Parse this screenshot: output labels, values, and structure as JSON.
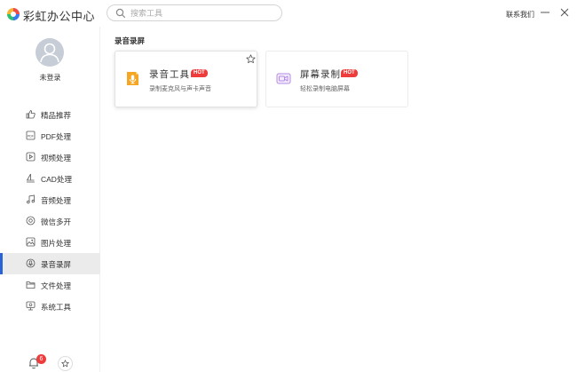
{
  "app": {
    "title": "彩虹办公中心"
  },
  "search": {
    "placeholder": "搜索工具",
    "value": ""
  },
  "header": {
    "contact": "联系我们"
  },
  "user": {
    "login_label": "未登录"
  },
  "sidebar": {
    "items": [
      {
        "label": "精品推荐",
        "icon": "thumbs-up-icon",
        "active": false
      },
      {
        "label": "PDF处理",
        "icon": "pdf-icon",
        "active": false
      },
      {
        "label": "视频处理",
        "icon": "video-icon",
        "active": false
      },
      {
        "label": "CAD处理",
        "icon": "cad-icon",
        "active": false
      },
      {
        "label": "音频处理",
        "icon": "music-note-icon",
        "active": false
      },
      {
        "label": "微信多开",
        "icon": "wechat-icon",
        "active": false
      },
      {
        "label": "图片处理",
        "icon": "image-icon",
        "active": false
      },
      {
        "label": "录音录屏",
        "icon": "record-icon",
        "active": true
      },
      {
        "label": "文件处理",
        "icon": "folder-icon",
        "active": false
      },
      {
        "label": "系统工具",
        "icon": "monitor-icon",
        "active": false
      }
    ],
    "notification_count": "6"
  },
  "main": {
    "section_title": "录音录屏",
    "cards": [
      {
        "title": "录音工具",
        "badge": "HOT",
        "desc": "录制麦克风与声卡声音",
        "icon": "microphone-icon"
      },
      {
        "title": "屏幕录制",
        "badge": "HOT",
        "desc": "轻松录制电脑屏幕",
        "icon": "screen-record-icon"
      }
    ]
  },
  "colors": {
    "accent": "#2a63d8",
    "hot": "#ee3b3b",
    "mic_orange": "#f5a623",
    "screen_purple": "#b48be6"
  }
}
